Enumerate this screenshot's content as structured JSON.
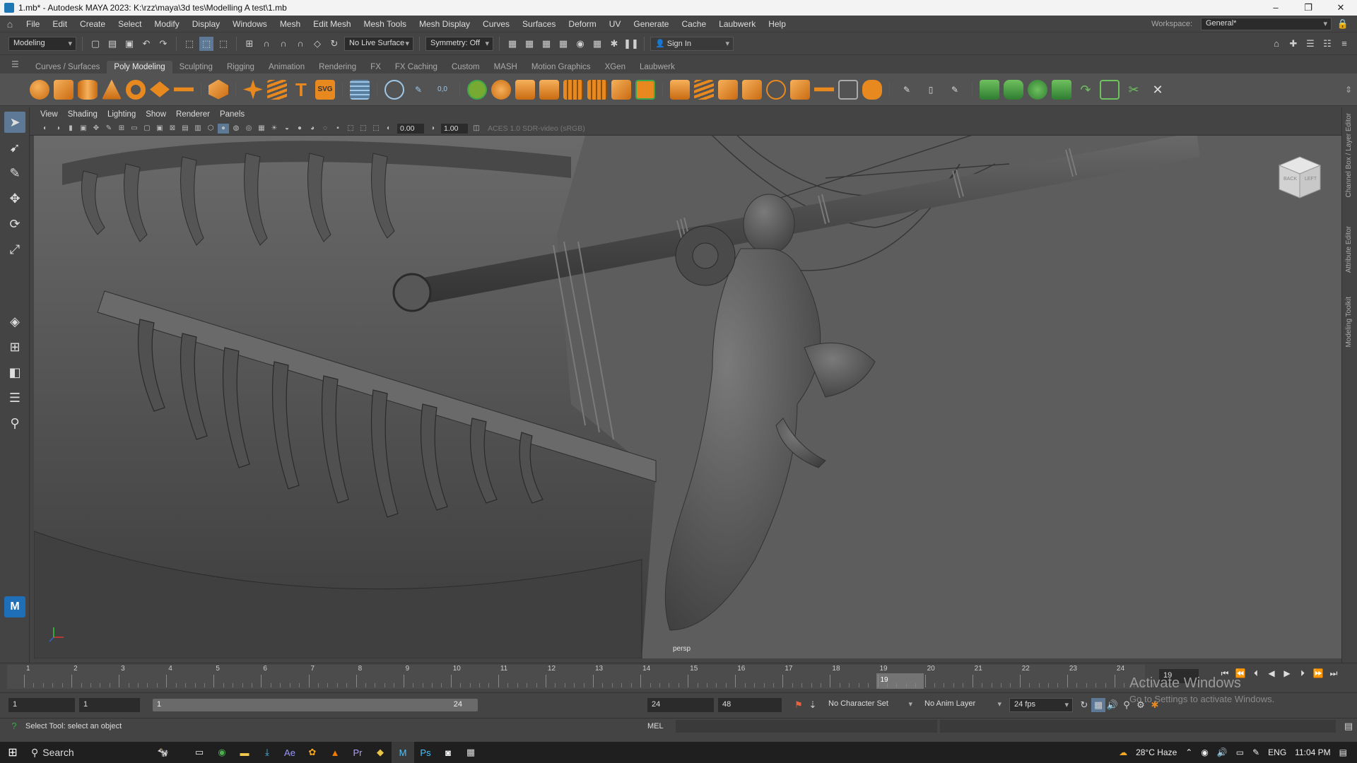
{
  "window": {
    "title": "1.mb* - Autodesk MAYA 2023: K:\\rzz\\maya\\3d tes\\Modelling A test\\1.mb",
    "minimize": "–",
    "maximize": "❐",
    "close": "✕"
  },
  "menubar": {
    "items": [
      "File",
      "Edit",
      "Create",
      "Select",
      "Modify",
      "Display",
      "Windows",
      "Mesh",
      "Edit Mesh",
      "Mesh Tools",
      "Mesh Display",
      "Curves",
      "Surfaces",
      "Deform",
      "UV",
      "Generate",
      "Cache",
      "Laubwerk",
      "Help"
    ],
    "workspace_label": "Workspace:",
    "workspace_value": "General*"
  },
  "statusline": {
    "menuset": "Modeling",
    "live_surface": "No Live Surface",
    "symmetry": "Symmetry: Off",
    "sign_in": "Sign In"
  },
  "shelf": {
    "tabs": [
      "Curves / Surfaces",
      "Poly Modeling",
      "Sculpting",
      "Rigging",
      "Animation",
      "Rendering",
      "FX",
      "FX Caching",
      "Custom",
      "MASH",
      "Motion Graphics",
      "XGen",
      "Laubwerk"
    ],
    "active_tab": "Poly Modeling",
    "icon_color_primary": "#e8891f",
    "icon_color_secondary": "#3fa64a",
    "svg_label": "SVG"
  },
  "panel": {
    "menus": [
      "View",
      "Shading",
      "Lighting",
      "Show",
      "Renderer",
      "Panels"
    ],
    "exposure": "0.00",
    "gamma": "1.00",
    "color_mgmt": "ACES 1.0 SDR-video (sRGB)",
    "camera_label": "persp",
    "viewcube_top": "BACK",
    "viewcube_side": "LEFT"
  },
  "sidetabs": [
    "Channel Box / Layer Editor",
    "Attribute Editor",
    "Modeling Toolkit"
  ],
  "timeslider": {
    "ticks": [
      "1",
      "2",
      "3",
      "4",
      "5",
      "6",
      "7",
      "8",
      "9",
      "10",
      "11",
      "12",
      "13",
      "14",
      "15",
      "16",
      "17",
      "18",
      "19",
      "20",
      "21",
      "22",
      "23",
      "24"
    ],
    "current_frame_marker": "19",
    "current_frame_field": "19"
  },
  "rangeslider": {
    "start_field": "1",
    "anim_start": "1",
    "range_start": "1",
    "range_end": "24",
    "range_end_field": "24",
    "anim_end": "48",
    "character_set": "No Character Set",
    "anim_layer": "No Anim Layer",
    "fps": "24 fps"
  },
  "helpline": {
    "text": "Select Tool: select an object",
    "mel_label": "MEL"
  },
  "watermark": {
    "title": "Activate Windows",
    "subtitle": "Go to Settings to activate Windows."
  },
  "taskbar": {
    "search": "Search",
    "weather": "28°C  Haze",
    "language": "ENG",
    "time": "11:04 PM"
  }
}
